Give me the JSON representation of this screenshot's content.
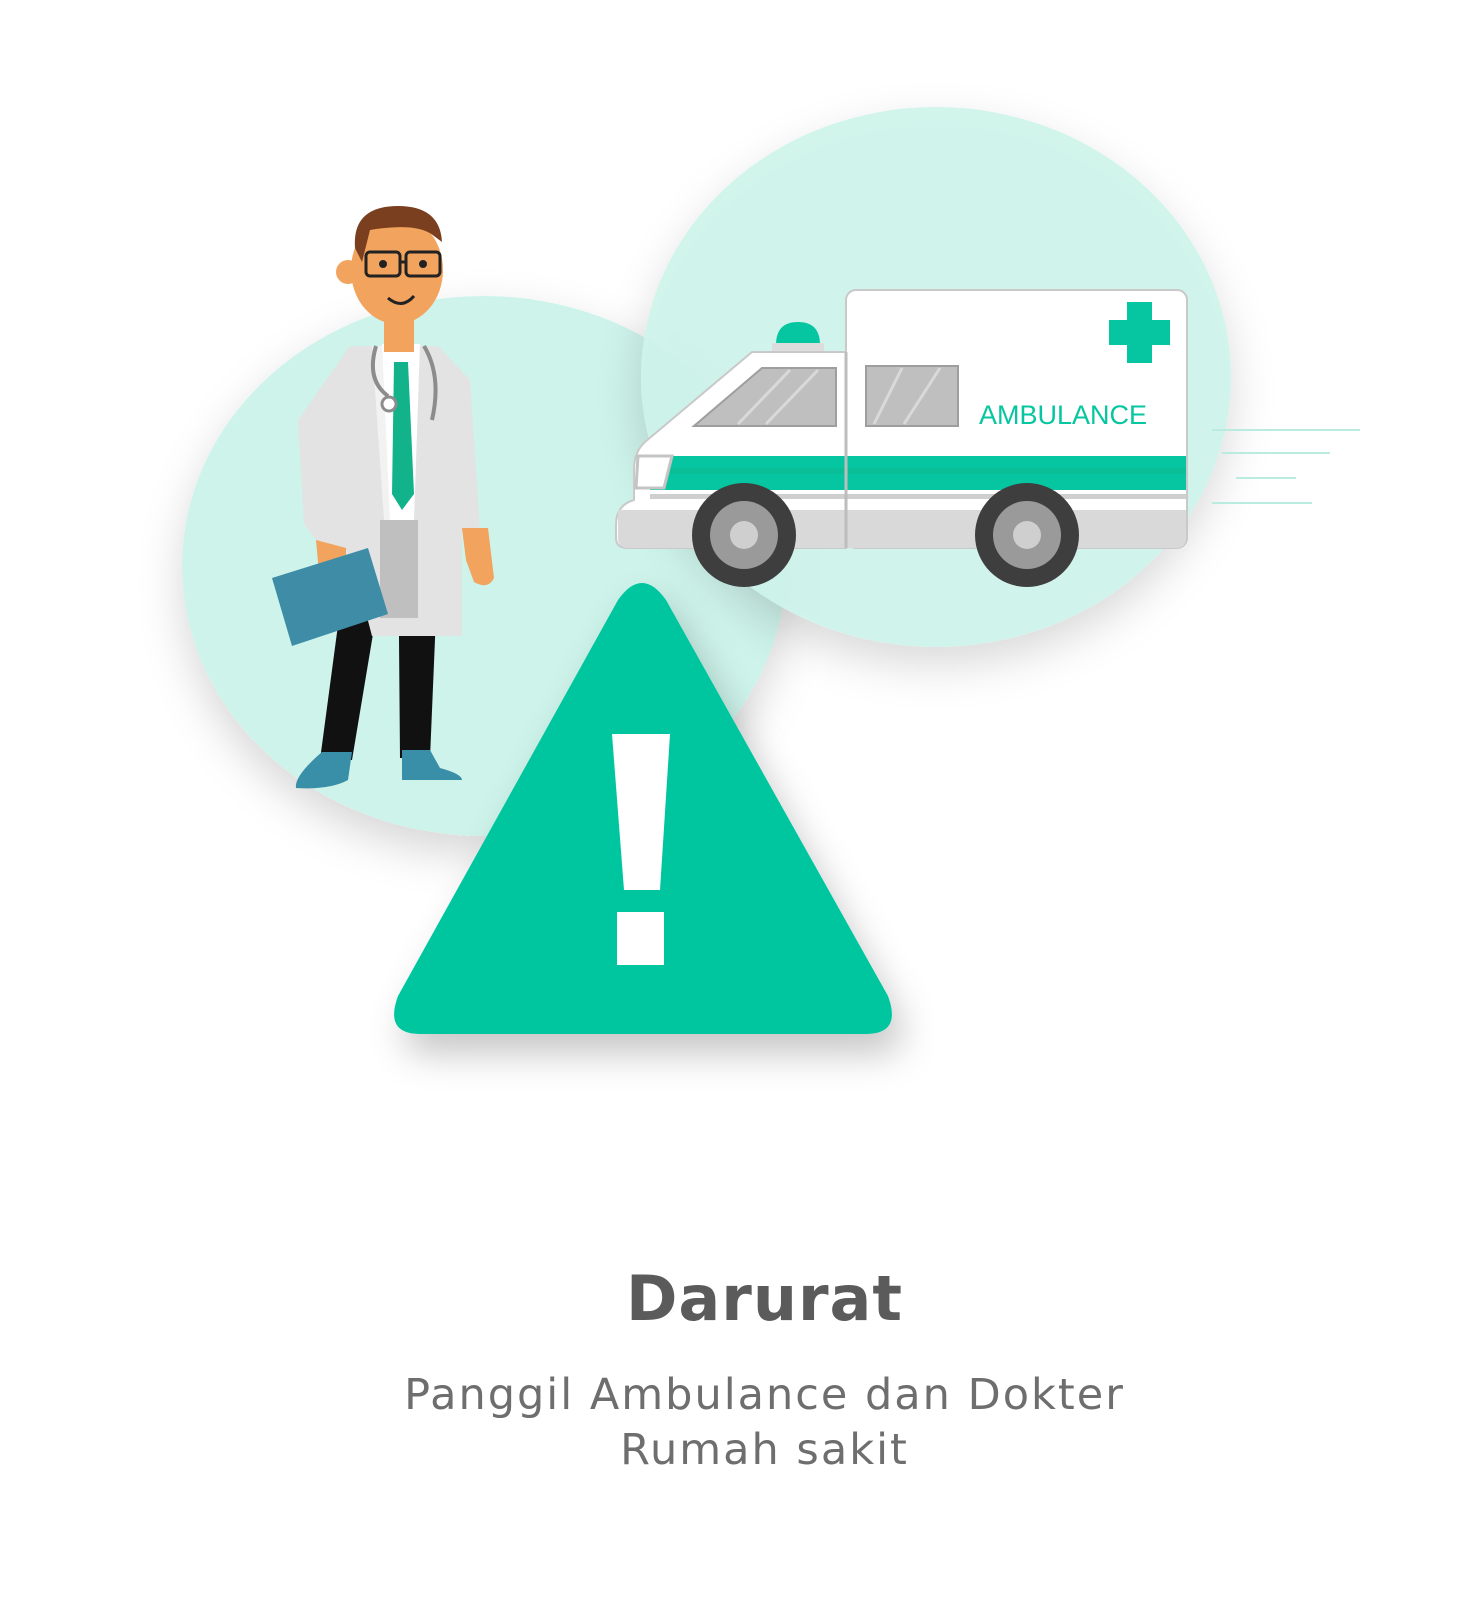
{
  "ambulance": {
    "label": "AMBULANCE"
  },
  "content": {
    "title": "Darurat",
    "subtitle_line1": "Panggil Ambulance dan Dokter",
    "subtitle_line2": "Rumah sakit"
  },
  "icons": {
    "warning": "warning-triangle-icon",
    "doctor": "doctor-illustration",
    "ambulance": "ambulance-illustration"
  },
  "colors": {
    "accent": "#05c6a0",
    "circle": "#cdf3ea",
    "title_text": "#5b5b5b",
    "subtitle_text": "#6e6e6e"
  }
}
